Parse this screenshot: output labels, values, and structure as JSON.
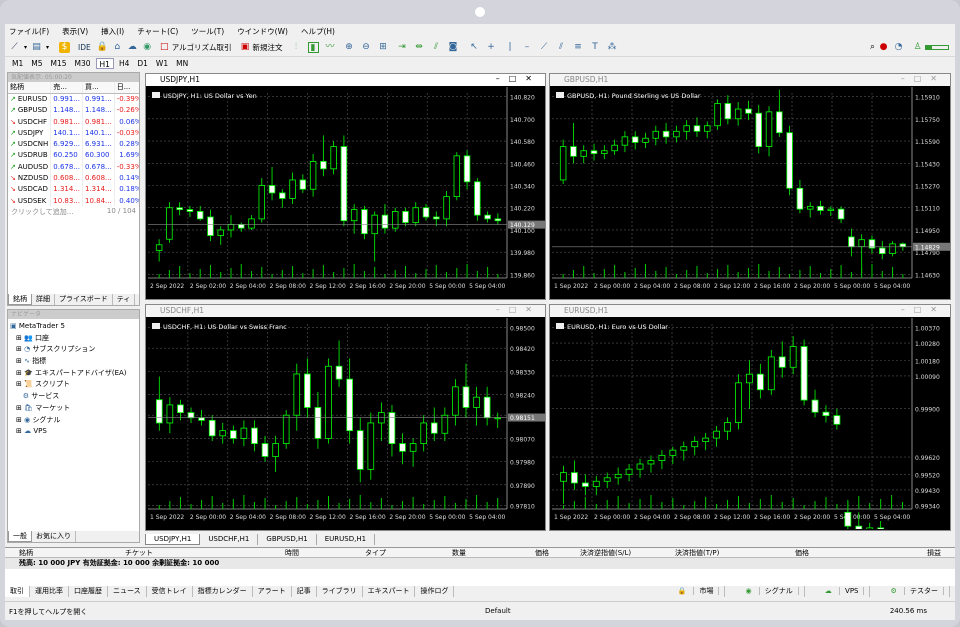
{
  "menu": [
    "ファイル(F)",
    "表示(V)",
    "挿入(I)",
    "チャート(C)",
    "ツール(T)",
    "ウインドウ(W)",
    "ヘルプ(H)"
  ],
  "toolbar": {
    "ide": "IDE",
    "algo": "アルゴリズム取引",
    "new_order": "新規注文"
  },
  "timeframes": [
    "M1",
    "M5",
    "M15",
    "M30",
    "H1",
    "H4",
    "D1",
    "W1",
    "MN"
  ],
  "active_tf": "H1",
  "market_watch": {
    "title": "気配値表示: 05:00:20",
    "headers": [
      "銘柄",
      "売...",
      "買...",
      "日..."
    ],
    "rows": [
      {
        "sym": "EURUSD",
        "bid": "0.991...",
        "ask": "0.991...",
        "chg": "-0.39%",
        "dir": "up",
        "neg": true
      },
      {
        "sym": "GBPUSD",
        "bid": "1.148...",
        "ask": "1.148...",
        "chg": "-0.26%",
        "dir": "up",
        "neg": true
      },
      {
        "sym": "USDCHF",
        "bid": "0.981...",
        "ask": "0.981...",
        "chg": "0.06%",
        "dir": "dn",
        "neg": false
      },
      {
        "sym": "USDJPY",
        "bid": "140.1...",
        "ask": "140.1...",
        "chg": "-0.03%",
        "dir": "up",
        "neg": true
      },
      {
        "sym": "USDCNH",
        "bid": "6.929...",
        "ask": "6.931...",
        "chg": "0.28%",
        "dir": "up",
        "neg": false
      },
      {
        "sym": "USDRUB",
        "bid": "60.250",
        "ask": "60.300",
        "chg": "1.69%",
        "dir": "up",
        "neg": false
      },
      {
        "sym": "AUDUSD",
        "bid": "0.678...",
        "ask": "0.678...",
        "chg": "-0.33%",
        "dir": "up",
        "neg": true
      },
      {
        "sym": "NZDUSD",
        "bid": "0.608...",
        "ask": "0.608...",
        "chg": "0.14%",
        "dir": "dn",
        "neg": false
      },
      {
        "sym": "USDCAD",
        "bid": "1.314...",
        "ask": "1.314...",
        "chg": "0.18%",
        "dir": "dn",
        "neg": false
      },
      {
        "sym": "USDSEK",
        "bid": "10.83...",
        "ask": "10.84...",
        "chg": "0.40%",
        "dir": "dn",
        "neg": false
      }
    ],
    "add_hint": "クリックして追加...",
    "count": "10 / 104",
    "tabs": [
      "銘柄",
      "詳細",
      "プライスボード",
      "ティ"
    ]
  },
  "navigator": {
    "title": "ナビゲータ",
    "items": [
      "MetaTrader 5",
      "口座",
      "サブスクリプション",
      "指標",
      "エキスパートアドバイザ(EA)",
      "スクリプト",
      "サービス",
      "マーケット",
      "シグナル",
      "VPS"
    ],
    "tabs": [
      "一般",
      "お気に入り"
    ]
  },
  "charts": [
    {
      "tab": "USDJPY,H1",
      "desc": "USDJPY, H1:  US Dollar vs Yen",
      "prices": [
        "140.820",
        "140.700",
        "140.580",
        "140.460",
        "140.340",
        "140.220",
        "140.100",
        "139.980",
        "139.860"
      ],
      "last": "140.129",
      "times": [
        "2 Sep 2022",
        "2 Sep 02:00",
        "2 Sep 04:00",
        "2 Sep 08:00",
        "2 Sep 12:00",
        "2 Sep 16:00",
        "2 Sep 20:00",
        "5 Sep 00:00",
        "5 Sep 04:00"
      ],
      "ohlc": [
        [
          139.99,
          140.05,
          139.93,
          140.02
        ],
        [
          140.05,
          140.25,
          140.03,
          140.22
        ],
        [
          140.22,
          140.25,
          140.18,
          140.21
        ],
        [
          140.21,
          140.23,
          140.17,
          140.2
        ],
        [
          140.2,
          140.23,
          140.15,
          140.16
        ],
        [
          140.17,
          140.21,
          140.04,
          140.07
        ],
        [
          140.07,
          140.12,
          140.02,
          140.1
        ],
        [
          140.1,
          140.18,
          140.06,
          140.13
        ],
        [
          140.13,
          140.14,
          140.09,
          140.11
        ],
        [
          140.11,
          140.18,
          140.1,
          140.16
        ],
        [
          140.16,
          140.38,
          140.14,
          140.34
        ],
        [
          140.34,
          140.44,
          140.26,
          140.3
        ],
        [
          140.3,
          140.32,
          140.22,
          140.27
        ],
        [
          140.27,
          140.41,
          140.24,
          140.37
        ],
        [
          140.37,
          140.4,
          140.3,
          140.32
        ],
        [
          140.32,
          140.51,
          140.28,
          140.47
        ],
        [
          140.47,
          140.61,
          140.39,
          140.43
        ],
        [
          140.43,
          140.58,
          140.4,
          140.55
        ],
        [
          140.55,
          140.61,
          140.12,
          140.15
        ],
        [
          140.15,
          140.24,
          140.08,
          140.21
        ],
        [
          140.21,
          140.23,
          140.05,
          140.08
        ],
        [
          140.08,
          140.2,
          139.93,
          140.18
        ],
        [
          140.18,
          140.24,
          140.08,
          140.11
        ],
        [
          140.11,
          140.22,
          140.09,
          140.2
        ],
        [
          140.2,
          140.22,
          140.12,
          140.14
        ],
        [
          140.14,
          140.25,
          140.12,
          140.22
        ],
        [
          140.22,
          140.24,
          140.15,
          140.17
        ],
        [
          140.17,
          140.2,
          140.12,
          140.16
        ],
        [
          140.16,
          140.31,
          140.12,
          140.28
        ],
        [
          140.28,
          140.52,
          140.26,
          140.5
        ],
        [
          140.5,
          140.53,
          140.32,
          140.36
        ],
        [
          140.36,
          140.38,
          140.15,
          140.18
        ],
        [
          140.18,
          140.2,
          140.14,
          140.16
        ],
        [
          140.16,
          140.19,
          140.13,
          140.15
        ]
      ]
    },
    {
      "tab": "GBPUSD,H1",
      "desc": "GBPUSD, H1:  Pound Sterling vs US Dollar",
      "prices": [
        "1.15910",
        "1.15750",
        "1.15590",
        "1.15430",
        "1.15270",
        "1.15110",
        "1.14950",
        "1.14790",
        "1.14630"
      ],
      "last": "1.14829",
      "times": [
        "1 Sep 2022",
        "2 Sep 00:00",
        "2 Sep 04:00",
        "2 Sep 08:00",
        "2 Sep 12:00",
        "2 Sep 16:00",
        "2 Sep 20:00",
        "5 Sep 00:00",
        "5 Sep 04:00"
      ],
      "ohlc": [
        [
          1.1531,
          1.156,
          1.1528,
          1.1555
        ],
        [
          1.1555,
          1.1572,
          1.1543,
          1.1548
        ],
        [
          1.1548,
          1.1556,
          1.1543,
          1.1552
        ],
        [
          1.1552,
          1.1557,
          1.1545,
          1.155
        ],
        [
          1.155,
          1.1556,
          1.1546,
          1.1552
        ],
        [
          1.1552,
          1.156,
          1.1549,
          1.1556
        ],
        [
          1.1556,
          1.1566,
          1.1551,
          1.1562
        ],
        [
          1.1562,
          1.1566,
          1.1553,
          1.1558
        ],
        [
          1.1558,
          1.1565,
          1.1554,
          1.1561
        ],
        [
          1.1561,
          1.157,
          1.1556,
          1.1566
        ],
        [
          1.1566,
          1.1572,
          1.1557,
          1.1562
        ],
        [
          1.1562,
          1.157,
          1.1558,
          1.1566
        ],
        [
          1.1566,
          1.1574,
          1.156,
          1.157
        ],
        [
          1.157,
          1.1576,
          1.1562,
          1.1566
        ],
        [
          1.1566,
          1.1573,
          1.1561,
          1.157
        ],
        [
          1.157,
          1.1589,
          1.1567,
          1.1586
        ],
        [
          1.1586,
          1.1592,
          1.1571,
          1.1575
        ],
        [
          1.1575,
          1.1587,
          1.157,
          1.1582
        ],
        [
          1.1582,
          1.1588,
          1.1574,
          1.1579
        ],
        [
          1.1579,
          1.1585,
          1.155,
          1.1555
        ],
        [
          1.1555,
          1.1584,
          1.1548,
          1.158
        ],
        [
          1.158,
          1.1596,
          1.1562,
          1.1565
        ],
        [
          1.1565,
          1.157,
          1.152,
          1.1525
        ],
        [
          1.1525,
          1.1531,
          1.1507,
          1.151
        ],
        [
          1.151,
          1.1515,
          1.1504,
          1.1512
        ],
        [
          1.1512,
          1.1516,
          1.1506,
          1.1509
        ],
        [
          1.1509,
          1.1512,
          1.1505,
          1.151
        ],
        [
          1.151,
          1.1512,
          1.15,
          1.1503
        ],
        [
          1.149,
          1.1496,
          1.1476,
          1.1483
        ],
        [
          1.1483,
          1.1492,
          1.1464,
          1.1488
        ],
        [
          1.1488,
          1.1491,
          1.1478,
          1.1482
        ],
        [
          1.1482,
          1.1487,
          1.1474,
          1.1478
        ],
        [
          1.1478,
          1.1487,
          1.1476,
          1.1485
        ],
        [
          1.1485,
          1.1486,
          1.148,
          1.1483
        ]
      ]
    },
    {
      "tab": "USDCHF,H1",
      "desc": "USDCHF, H1:  US Dollar vs Swiss Franc",
      "prices": [
        "0.98500",
        "0.98420",
        "0.98330",
        "0.98240",
        "0.98160",
        "0.98070",
        "0.97980",
        "0.97890",
        "0.97810"
      ],
      "last": "0.98151",
      "times": [
        "1 Sep 2022",
        "2 Sep 00:00",
        "2 Sep 04:00",
        "2 Sep 08:00",
        "2 Sep 12:00",
        "2 Sep 16:00",
        "2 Sep 20:00",
        "5 Sep 00:00",
        "5 Sep 04:00"
      ],
      "ohlc": [
        [
          0.9822,
          0.9831,
          0.981,
          0.9813
        ],
        [
          0.9813,
          0.9823,
          0.9809,
          0.982
        ],
        [
          0.982,
          0.9822,
          0.9814,
          0.9817
        ],
        [
          0.9817,
          0.9819,
          0.9813,
          0.9815
        ],
        [
          0.9815,
          0.9818,
          0.9812,
          0.9814
        ],
        [
          0.9814,
          0.9816,
          0.9806,
          0.9808
        ],
        [
          0.9808,
          0.9813,
          0.9805,
          0.981
        ],
        [
          0.981,
          0.9812,
          0.9805,
          0.9807
        ],
        [
          0.9807,
          0.9814,
          0.9804,
          0.9811
        ],
        [
          0.9811,
          0.9814,
          0.9802,
          0.9805
        ],
        [
          0.9805,
          0.9808,
          0.9798,
          0.98
        ],
        [
          0.98,
          0.9808,
          0.9794,
          0.9805
        ],
        [
          0.9805,
          0.9818,
          0.9803,
          0.9816
        ],
        [
          0.9816,
          0.9836,
          0.981,
          0.9832
        ],
        [
          0.9832,
          0.9838,
          0.9815,
          0.9819
        ],
        [
          0.9819,
          0.9825,
          0.9803,
          0.9807
        ],
        [
          0.9807,
          0.9838,
          0.9805,
          0.9835
        ],
        [
          0.9835,
          0.9845,
          0.9827,
          0.983
        ],
        [
          0.983,
          0.9838,
          0.9805,
          0.981
        ],
        [
          0.981,
          0.9815,
          0.979,
          0.9795
        ],
        [
          0.9795,
          0.9817,
          0.9791,
          0.9813
        ],
        [
          0.9813,
          0.9821,
          0.9806,
          0.9817
        ],
        [
          0.9817,
          0.982,
          0.98,
          0.9805
        ],
        [
          0.9805,
          0.9809,
          0.9797,
          0.9802
        ],
        [
          0.9802,
          0.9807,
          0.9796,
          0.9805
        ],
        [
          0.9805,
          0.9816,
          0.9802,
          0.9813
        ],
        [
          0.9813,
          0.9819,
          0.9806,
          0.9809
        ],
        [
          0.9809,
          0.9819,
          0.9806,
          0.9816
        ],
        [
          0.9816,
          0.983,
          0.9812,
          0.9827
        ],
        [
          0.9827,
          0.9836,
          0.9815,
          0.9819
        ],
        [
          0.9819,
          0.9827,
          0.9812,
          0.9823
        ],
        [
          0.9823,
          0.9827,
          0.9812,
          0.9815
        ],
        [
          0.9815,
          0.9817,
          0.9811,
          0.9815
        ]
      ]
    },
    {
      "tab": "EURUSD,H1",
      "desc": "EURUSD, H1:  Euro vs US Dollar",
      "prices": [
        "1.00370",
        "1.00280",
        "1.00180",
        "1.00090",
        "0.99900",
        "0.99620",
        "0.99520",
        "0.99430",
        "0.99340"
      ],
      "last": "0.99136",
      "times": [
        "1 Sep 2022",
        "2 Sep 00:00",
        "2 Sep 04:00",
        "2 Sep 08:00",
        "2 Sep 12:00",
        "2 Sep 16:00",
        "2 Sep 20:00",
        "5 Sep 00:00",
        "5 Sep 04:00"
      ],
      "ohlc": [
        [
          0.9948,
          0.9957,
          0.9935,
          0.9953
        ],
        [
          0.9953,
          0.996,
          0.9943,
          0.9947
        ],
        [
          0.9947,
          0.9952,
          0.994,
          0.9945
        ],
        [
          0.9945,
          0.9951,
          0.994,
          0.9948
        ],
        [
          0.9948,
          0.9953,
          0.9944,
          0.995
        ],
        [
          0.995,
          0.9956,
          0.9946,
          0.9952
        ],
        [
          0.9952,
          0.9958,
          0.9948,
          0.9955
        ],
        [
          0.9955,
          0.9961,
          0.995,
          0.9958
        ],
        [
          0.9958,
          0.9963,
          0.9953,
          0.996
        ],
        [
          0.996,
          0.9966,
          0.9955,
          0.9963
        ],
        [
          0.9963,
          0.9968,
          0.9958,
          0.9966
        ],
        [
          0.9966,
          0.9971,
          0.996,
          0.9968
        ],
        [
          0.9968,
          0.9974,
          0.9963,
          0.9971
        ],
        [
          0.9971,
          0.9976,
          0.9966,
          0.9973
        ],
        [
          0.9973,
          0.998,
          0.9968,
          0.9977
        ],
        [
          0.9977,
          0.9985,
          0.9972,
          0.9982
        ],
        [
          0.9982,
          1.001,
          0.9978,
          1.0005
        ],
        [
          1.0005,
          1.0018,
          0.999,
          1.001
        ],
        [
          1.001,
          1.0016,
          0.9996,
          1.0001
        ],
        [
          1.0001,
          1.0024,
          0.9998,
          1.002
        ],
        [
          1.002,
          1.0029,
          1.0008,
          1.0014
        ],
        [
          1.0014,
          1.0032,
          1.001,
          1.0026
        ],
        [
          1.0026,
          1.003,
          0.9992,
          0.9995
        ],
        [
          0.9995,
          1.0001,
          0.9985,
          0.9988
        ],
        [
          0.9988,
          0.9992,
          0.9982,
          0.9986
        ],
        [
          0.9986,
          0.999,
          0.9978,
          0.9981
        ],
        [
          0.993,
          0.9936,
          0.9918,
          0.9922
        ],
        [
          0.9922,
          0.993,
          0.9908,
          0.9914
        ],
        [
          0.9914,
          0.9924,
          0.9911,
          0.9921
        ],
        [
          0.9921,
          0.9925,
          0.9908,
          0.9912
        ],
        [
          0.9912,
          0.9918,
          0.9907,
          0.9915
        ],
        [
          0.9915,
          0.9917,
          0.9911,
          0.9913
        ]
      ]
    }
  ],
  "doc_tabs": [
    "USDJPY,H1",
    "USDCHF,H1",
    "GBPUSD,H1",
    "EURUSD,H1"
  ],
  "terminal": {
    "cols": [
      "銘柄",
      "チケット",
      "時間",
      "タイプ",
      "数量",
      "価格",
      "決済逆指値(S/L)",
      "決済指値(T/P)",
      "価格",
      "損益"
    ],
    "balance": "残高: 10 000 JPY  有効証拠金: 10 000  余剰証拠金: 10 000",
    "side_label": "ツールボックス",
    "tabs": [
      "取引",
      "運用比率",
      "口座履歴",
      "ニュース",
      "受信トレイ",
      "指標カレンダー",
      "アラート",
      "記事",
      "ライブラリ",
      "エキスパート",
      "操作ログ"
    ],
    "right": [
      "市場",
      "シグナル",
      "VPS",
      "テスター"
    ]
  },
  "status": {
    "help": "F1を押してヘルプを開く",
    "profile": "Default",
    "ping": "240.56 ms"
  }
}
